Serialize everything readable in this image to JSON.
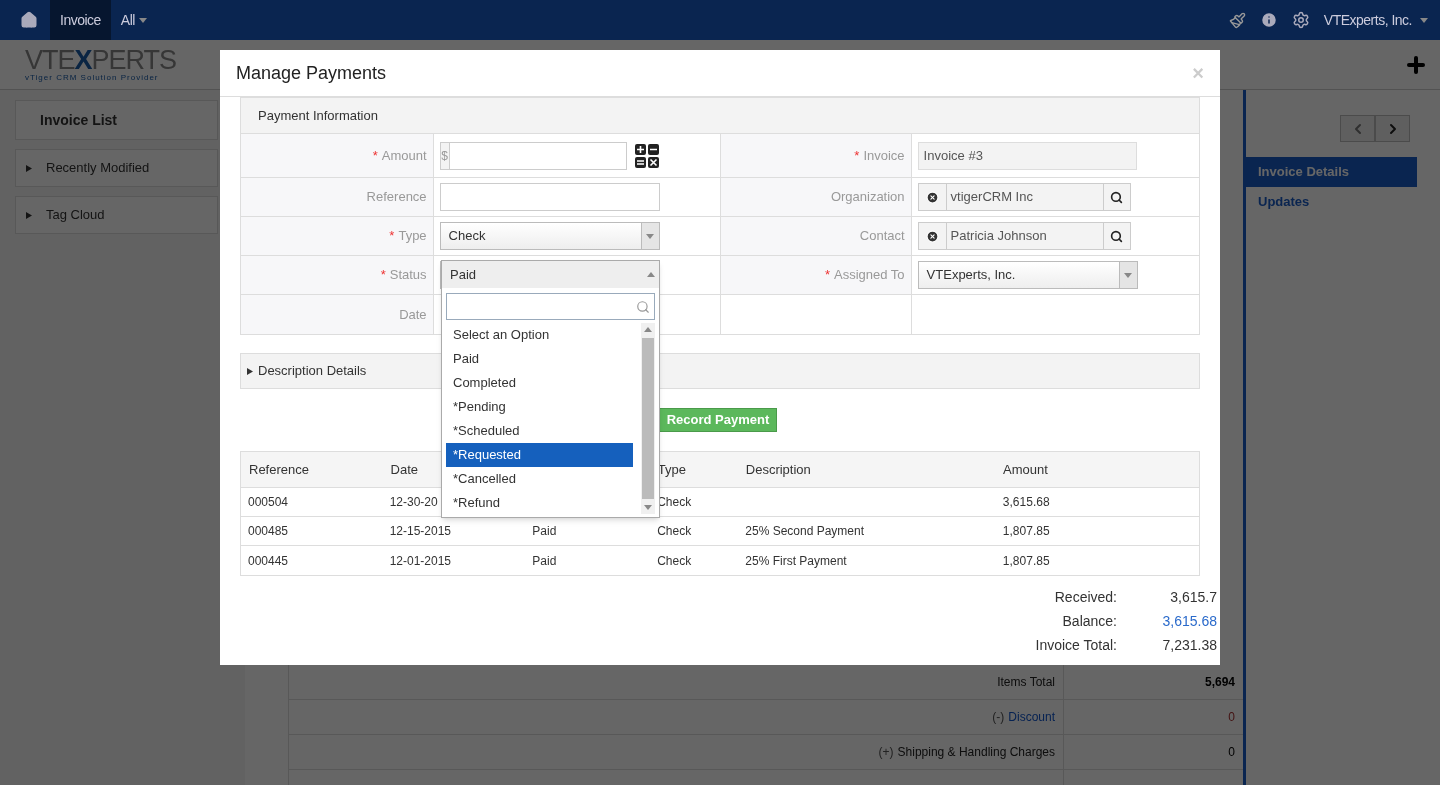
{
  "nav": {
    "tabs": [
      {
        "label": "Invoice",
        "selected": true
      },
      {
        "label": "All",
        "selected": false
      }
    ],
    "user": "VTExperts, Inc."
  },
  "logo": {
    "prefix": "VTE",
    "accent": "X",
    "suffix": "PERTS",
    "tagline": "vTiger  CRM Solution Provider"
  },
  "sidebar": {
    "title": "Invoice List",
    "items": [
      "Recently Modified",
      "Tag Cloud"
    ]
  },
  "right_panel": {
    "items": [
      {
        "label": "Invoice Details",
        "selected": true
      },
      {
        "label": "Updates",
        "selected": false
      }
    ]
  },
  "summary": [
    {
      "label": "Items Total",
      "value": "5,694",
      "kind": "bold"
    },
    {
      "prefix": "(-)",
      "label": "Discount",
      "value": "0",
      "kind": "link"
    },
    {
      "prefix": "(+)",
      "label": "Shipping & Handling Charges",
      "value": "0",
      "kind": "plain"
    }
  ],
  "modal": {
    "title": "Manage Payments",
    "close": "×",
    "required_mark": "*",
    "section": "Payment Information",
    "rows": [
      [
        {
          "label": "Amount",
          "required": true,
          "kind": "currency",
          "prefix": "$"
        },
        {
          "label": "Invoice",
          "required": true,
          "kind": "readonly",
          "value": "Invoice #3"
        }
      ],
      [
        {
          "label": "Reference",
          "required": false,
          "kind": "text"
        },
        {
          "label": "Organization",
          "required": false,
          "kind": "lookup",
          "value": "vtigerCRM Inc"
        }
      ],
      [
        {
          "label": "Type",
          "required": true,
          "kind": "select",
          "value": "Check",
          "open": false
        },
        {
          "label": "Contact",
          "required": false,
          "kind": "lookup",
          "value": "Patricia Johnson"
        }
      ],
      [
        {
          "label": "Status",
          "required": true,
          "kind": "select",
          "value": "Paid",
          "open": true
        },
        {
          "label": "Assigned To",
          "required": true,
          "kind": "select",
          "value": "VTExperts, Inc.",
          "open": false
        }
      ],
      [
        {
          "label": "Date",
          "required": false,
          "kind": "hidden"
        },
        null
      ]
    ],
    "dropdown": {
      "options": [
        {
          "label": "Select an Option",
          "selected": false
        },
        {
          "label": "Paid",
          "selected": false
        },
        {
          "label": "Completed",
          "selected": false
        },
        {
          "label": "*Pending",
          "selected": false
        },
        {
          "label": "*Scheduled",
          "selected": false
        },
        {
          "label": "*Requested",
          "selected": true
        },
        {
          "label": "*Cancelled",
          "selected": false
        },
        {
          "label": "*Refund",
          "selected": false
        }
      ]
    },
    "description": {
      "label": "Description Details",
      "expanded": false
    },
    "record_button": "Record Payment",
    "table": {
      "columns": [
        "Reference",
        "Date",
        null,
        "Type",
        "Description",
        "Amount"
      ],
      "rows": [
        [
          "000504",
          "12-30-20",
          null,
          "Check",
          null,
          "3,615.68"
        ],
        [
          "000485",
          "12-15-2015",
          "Paid",
          "Check",
          "25% Second Payment",
          "1,807.85"
        ],
        [
          "000445",
          "12-01-2015",
          "Paid",
          "Check",
          "25% First Payment",
          "1,807.85"
        ]
      ]
    },
    "totals": [
      {
        "label": "Received:",
        "value": "3,615.7",
        "kind": "plain"
      },
      {
        "label": "Balance:",
        "value": "3,615.68",
        "kind": "link"
      },
      {
        "label": "Invoice Total:",
        "value": "7,231.38",
        "kind": "plain"
      }
    ]
  }
}
